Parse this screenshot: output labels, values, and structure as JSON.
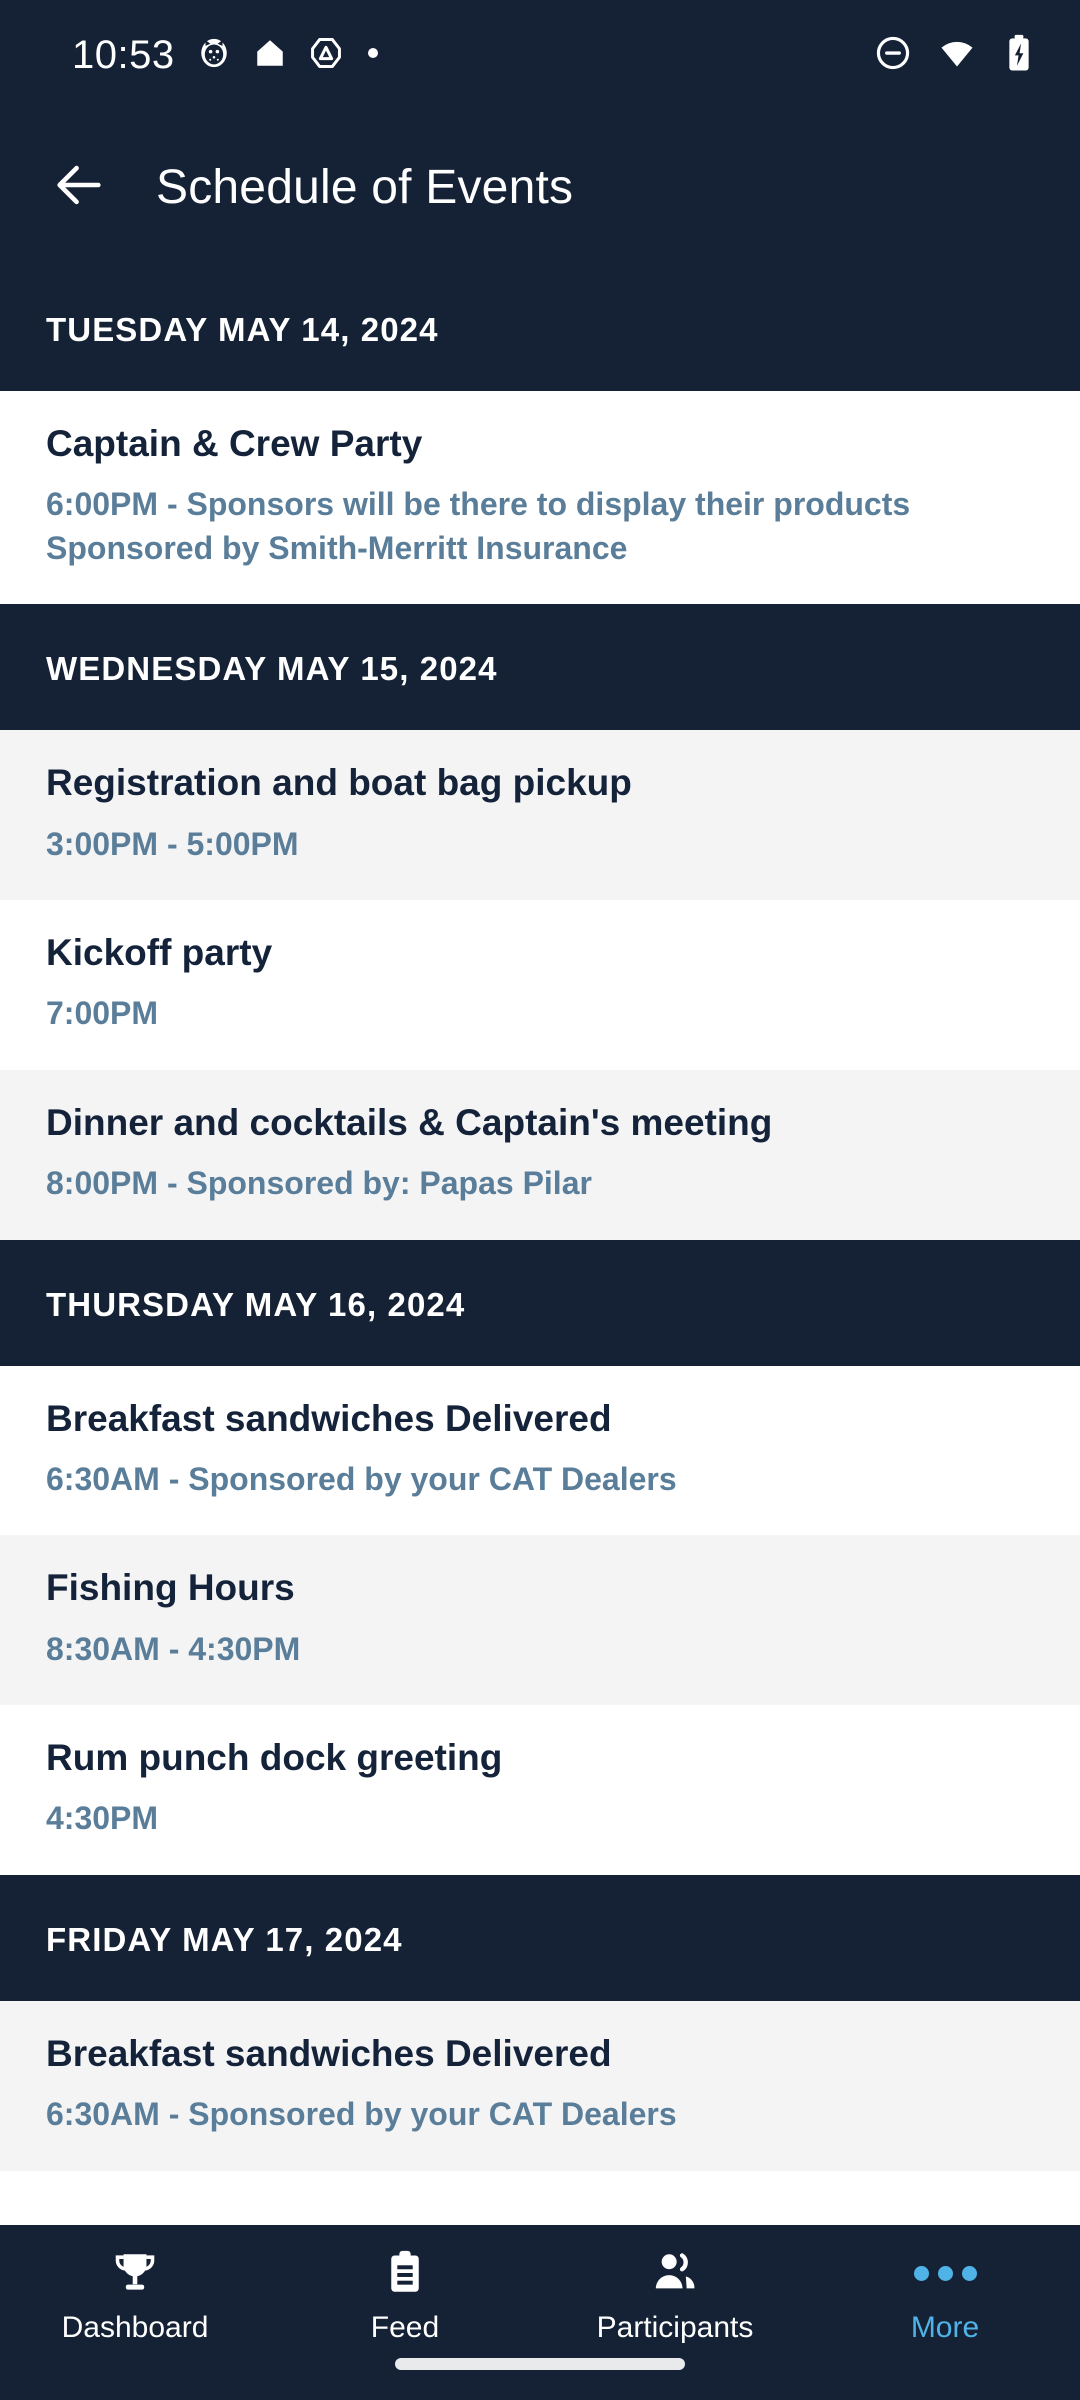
{
  "status_bar": {
    "time": "10:53",
    "notification_icons": [
      "cat-face-icon",
      "home-icon",
      "drive-icon",
      "dot-icon"
    ],
    "right_icons": [
      "do-not-disturb-icon",
      "wifi-icon",
      "battery-charging-icon"
    ]
  },
  "app_bar": {
    "back_icon": "back-arrow-icon",
    "title": "Schedule of Events"
  },
  "colors": {
    "header_navy": "#152235",
    "title_navy": "#14233a",
    "subtitle_blue": "#5a7e99",
    "accent_blue": "#4fb3e8",
    "row_white": "#ffffff",
    "row_grey": "#f4f4f5"
  },
  "schedule": [
    {
      "date": "TUESDAY MAY 14, 2024",
      "events": [
        {
          "title": "Captain & Crew Party",
          "subtitle": "6:00PM - Sponsors will be there to display their products Sponsored by Smith-Merritt Insurance",
          "shade": "white"
        }
      ]
    },
    {
      "date": "WEDNESDAY MAY 15, 2024",
      "events": [
        {
          "title": "Registration and boat bag pickup",
          "subtitle": "3:00PM - 5:00PM",
          "shade": "grey"
        },
        {
          "title": "Kickoff party",
          "subtitle": "7:00PM",
          "shade": "white"
        },
        {
          "title": "Dinner and cocktails & Captain's meeting",
          "subtitle": "8:00PM - Sponsored by: Papas Pilar",
          "shade": "grey"
        }
      ]
    },
    {
      "date": "THURSDAY MAY 16, 2024",
      "events": [
        {
          "title": "Breakfast sandwiches Delivered",
          "subtitle": "6:30AM - Sponsored by your CAT Dealers",
          "shade": "white"
        },
        {
          "title": "Fishing Hours",
          "subtitle": "8:30AM - 4:30PM",
          "shade": "grey"
        },
        {
          "title": "Rum punch dock greeting",
          "subtitle": "4:30PM",
          "shade": "white"
        }
      ]
    },
    {
      "date": "FRIDAY MAY 17, 2024",
      "events": [
        {
          "title": "Breakfast sandwiches Delivered",
          "subtitle": "6:30AM - Sponsored by your CAT Dealers",
          "shade": "grey"
        }
      ]
    }
  ],
  "bottom_nav": [
    {
      "label": "Dashboard",
      "icon": "trophy-icon",
      "active": false
    },
    {
      "label": "Feed",
      "icon": "clipboard-icon",
      "active": false
    },
    {
      "label": "Participants",
      "icon": "people-icon",
      "active": false
    },
    {
      "label": "More",
      "icon": "more-dots-icon",
      "active": true
    }
  ]
}
